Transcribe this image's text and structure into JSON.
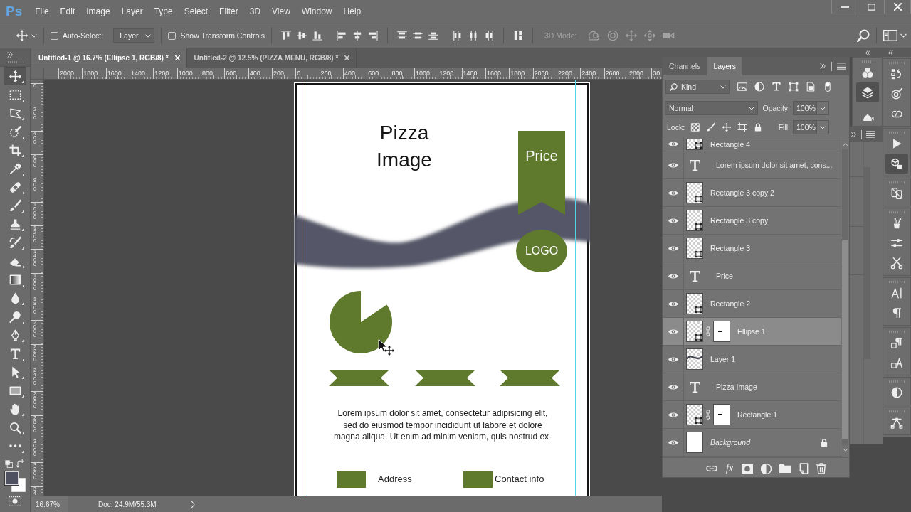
{
  "app_logo": "Ps",
  "menu": [
    "File",
    "Edit",
    "Image",
    "Layer",
    "Type",
    "Select",
    "Filter",
    "3D",
    "View",
    "Window",
    "Help"
  ],
  "options_bar": {
    "auto_select": {
      "label": "Auto-Select:",
      "checked": false
    },
    "auto_select_target": "Layer",
    "transform_controls": {
      "label": "Show Transform Controls",
      "checked": false
    },
    "mode_3d": {
      "label": "3D Mode:",
      "disabled": true
    }
  },
  "document_tabs": [
    {
      "title": "Untitled-1 @ 16.7% (Ellipse 1, RGB/8) *",
      "selected": true
    },
    {
      "title": "Untitled-2 @ 12.5% (PIZZA MENU, RGB/8) *",
      "selected": false
    }
  ],
  "rulers": {
    "horizontal": [
      "2000",
      "1800",
      "1600",
      "1400",
      "1200",
      "1000",
      "800",
      "600",
      "400",
      "200",
      "0",
      "200",
      "400",
      "600",
      "800",
      "1000",
      "1200",
      "1400",
      "1600",
      "1800",
      "2000",
      "2200",
      "2400",
      "2600",
      "2800",
      "30"
    ],
    "vertical": [
      "0",
      "200",
      "400",
      "600",
      "800",
      "1000",
      "1200",
      "1400",
      "1600",
      "1800",
      "2000",
      "2200",
      "2400",
      "2600",
      "2800",
      "3000",
      "3200",
      "34"
    ]
  },
  "tools": [
    {
      "kind": "move",
      "selected": true
    },
    {
      "kind": "marquee",
      "selected": false
    },
    {
      "kind": "lasso",
      "selected": false
    },
    {
      "kind": "quickselect",
      "selected": false
    },
    {
      "kind": "crop",
      "selected": false
    },
    {
      "kind": "eyedropper",
      "selected": false
    },
    {
      "kind": "healing",
      "selected": false
    },
    {
      "kind": "brush",
      "selected": false
    },
    {
      "kind": "stamp",
      "selected": false
    },
    {
      "kind": "historybrush",
      "selected": false
    },
    {
      "kind": "eraser",
      "selected": false
    },
    {
      "kind": "gradient",
      "selected": false
    },
    {
      "kind": "blur",
      "selected": false
    },
    {
      "kind": "dodge",
      "selected": false
    },
    {
      "kind": "pen",
      "selected": false
    },
    {
      "kind": "type",
      "selected": false
    },
    {
      "kind": "pathselect",
      "selected": false
    },
    {
      "kind": "shape",
      "selected": false
    },
    {
      "kind": "hand",
      "selected": false
    },
    {
      "kind": "zoom",
      "selected": false
    },
    {
      "kind": "more",
      "selected": false
    }
  ],
  "swatches": [
    {
      "kind": "foreground",
      "color": "#4f5160"
    },
    {
      "kind": "background",
      "color": "#ffffff"
    }
  ],
  "canvas": {
    "title": "Pizza Image",
    "price": "Price",
    "logo": "LOGO",
    "paragraph": "Lorem ipsum dolor sit amet, consectetur adipisicing elit,\nsed do eiusmod tempor incididunt ut labore et dolore\nmagna aliqua. Ut enim ad minim veniam, quis nostrud ex-",
    "contacts": [
      {
        "label": "Address"
      },
      {
        "label": "Contact info"
      }
    ]
  },
  "status_bar": {
    "zoom": "16.67%",
    "doc_info": "Doc: 24.9M/55.3M"
  },
  "layers_panel": {
    "tabs": [
      {
        "label": "Channels",
        "selected": false
      },
      {
        "label": "Layers",
        "selected": true
      }
    ],
    "filter": "Kind",
    "blend_mode": "Normal",
    "opacity": {
      "label": "Opacity:",
      "value": "100%"
    },
    "lock_label": "Lock:",
    "fill": {
      "label": "Fill:",
      "value": "100%"
    },
    "layers": [
      {
        "name": "Rectangle 4",
        "kind": "shape",
        "visible": true,
        "selected": false,
        "mask": false,
        "locked": false
      },
      {
        "name": "Lorem ipsum dolor sit amet, cons...",
        "kind": "text",
        "visible": true,
        "selected": false,
        "mask": false,
        "locked": false
      },
      {
        "name": "Rectangle 3 copy 2",
        "kind": "shape",
        "visible": true,
        "selected": false,
        "mask": false,
        "locked": false
      },
      {
        "name": "Rectangle 3 copy",
        "kind": "shape",
        "visible": true,
        "selected": false,
        "mask": false,
        "locked": false
      },
      {
        "name": "Rectangle 3",
        "kind": "shape",
        "visible": true,
        "selected": false,
        "mask": false,
        "locked": false
      },
      {
        "name": "Price",
        "kind": "text",
        "visible": true,
        "selected": false,
        "mask": false,
        "locked": false
      },
      {
        "name": "Rectangle 2",
        "kind": "shape",
        "visible": true,
        "selected": false,
        "mask": false,
        "locked": false
      },
      {
        "name": "Ellipse 1",
        "kind": "shape",
        "visible": true,
        "selected": true,
        "mask": true,
        "locked": false
      },
      {
        "name": "Layer 1",
        "kind": "pixel",
        "visible": true,
        "selected": false,
        "mask": false,
        "locked": false
      },
      {
        "name": "Pizza Image",
        "kind": "text",
        "visible": true,
        "selected": false,
        "mask": false,
        "locked": false
      },
      {
        "name": "Rectangle 1",
        "kind": "shape",
        "visible": true,
        "selected": false,
        "mask": true,
        "locked": false
      },
      {
        "name": "Background",
        "kind": "background",
        "visible": true,
        "selected": false,
        "mask": false,
        "locked": true
      }
    ],
    "effects_label": "fx"
  },
  "dock": {
    "column_1": [
      {
        "kind": "colors",
        "selected": false
      },
      {
        "kind": "layers",
        "selected": true
      },
      {
        "kind": "teapot",
        "selected": false
      }
    ],
    "column_2": [
      {
        "icons": [
          {
            "kind": "history",
            "selected": false
          },
          {
            "kind": "target",
            "selected": false
          },
          {
            "kind": "libraries",
            "selected": false
          }
        ]
      },
      {
        "icons": [
          {
            "kind": "play",
            "selected": false
          },
          {
            "kind": "properties",
            "selected": true
          }
        ]
      },
      {
        "icons": [
          {
            "kind": "device",
            "selected": false
          }
        ]
      },
      {
        "icons": [
          {
            "kind": "brushes",
            "selected": false
          },
          {
            "kind": "sliders",
            "selected": false
          },
          {
            "kind": "scissors",
            "selected": false
          }
        ]
      },
      {
        "icons": [
          {
            "kind": "character",
            "selected": false
          },
          {
            "kind": "paragraph",
            "selected": false
          }
        ]
      },
      {
        "icons": [
          {
            "kind": "parastyle",
            "selected": false
          },
          {
            "kind": "charstyle",
            "selected": false
          }
        ]
      },
      {
        "icons": [
          {
            "kind": "adjust",
            "selected": false
          }
        ]
      },
      {
        "icons": [
          {
            "kind": "paths",
            "selected": false
          }
        ]
      }
    ]
  }
}
